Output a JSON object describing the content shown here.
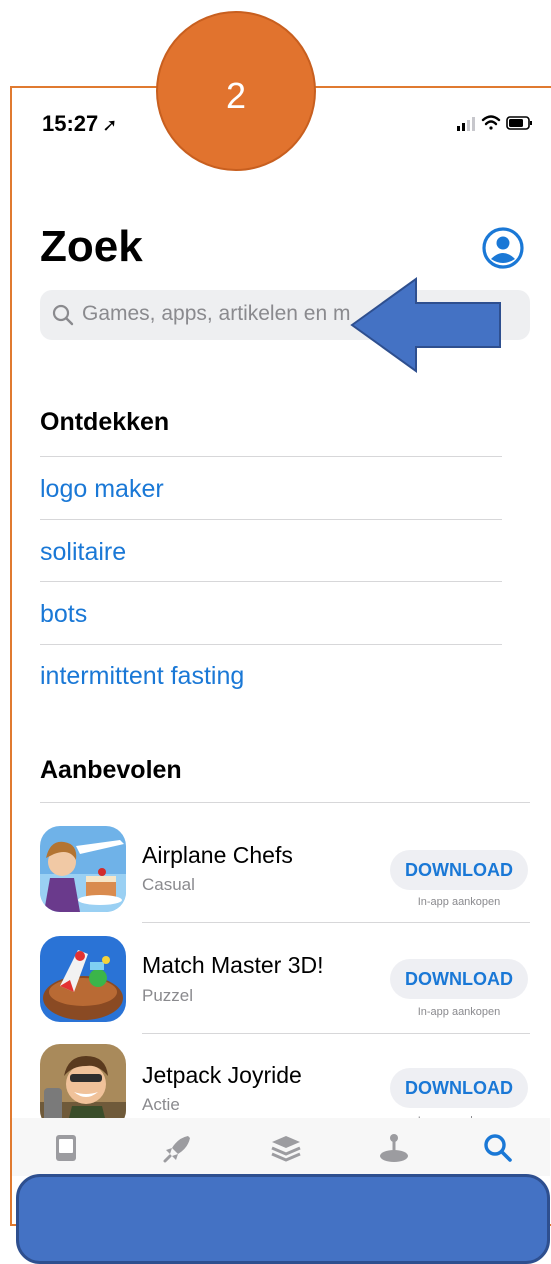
{
  "annotation": {
    "step_number": "2"
  },
  "status_bar": {
    "time": "15:27",
    "location_arrow": "location-arrow-icon"
  },
  "header": {
    "title": "Zoek",
    "profile_icon": "person-circle-icon"
  },
  "search": {
    "placeholder": "Games, apps, artikelen en m"
  },
  "discover": {
    "title": "Ontdekken",
    "items": [
      "logo maker",
      "solitaire",
      "bots",
      "intermittent fasting"
    ]
  },
  "recommended": {
    "title": "Aanbevolen",
    "apps": [
      {
        "name": "Airplane Chefs",
        "category": "Casual",
        "button": "DOWNLOAD",
        "note": "In-app aankopen"
      },
      {
        "name": "Match Master 3D!",
        "category": "Puzzel",
        "button": "DOWNLOAD",
        "note": "In-app aankopen"
      },
      {
        "name": "Jetpack Joyride",
        "category": "Actie",
        "button": "DOWNLOAD",
        "note": "In-app aankopen"
      }
    ]
  },
  "tab_bar": {
    "icons": [
      "today-icon",
      "rocket-icon",
      "stack-icon",
      "joystick-icon",
      "search-icon"
    ],
    "active_index": 4
  },
  "colors": {
    "accent": "#1a78d6",
    "annotation_orange": "#e1732e",
    "annotation_blue": "#4472c4"
  }
}
